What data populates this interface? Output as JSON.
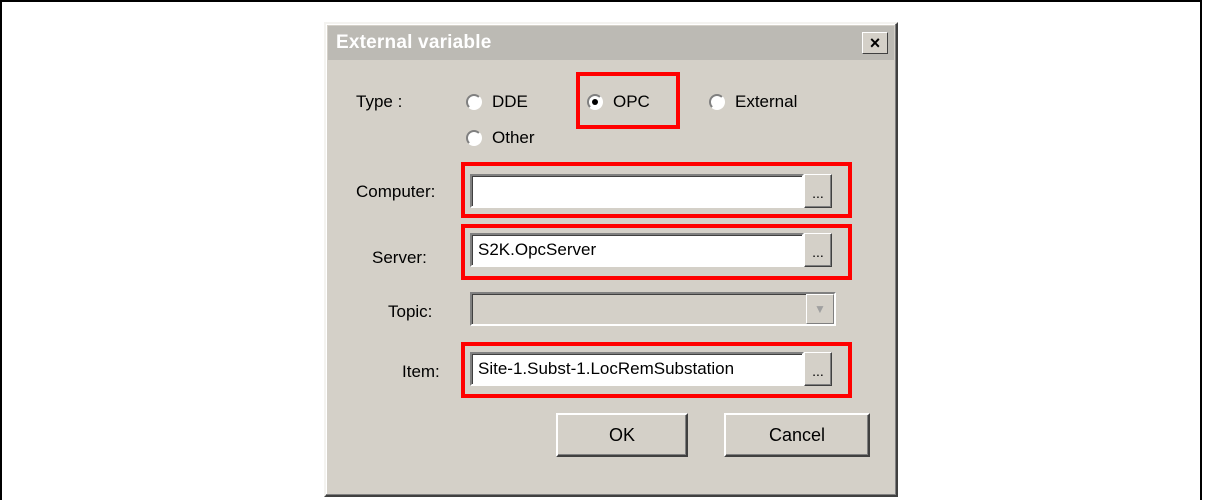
{
  "dialog": {
    "title": "External variable",
    "close_label": "×"
  },
  "type": {
    "label": "Type :",
    "options": [
      {
        "label": "DDE",
        "selected": false
      },
      {
        "label": "OPC",
        "selected": true
      },
      {
        "label": "External",
        "selected": false
      },
      {
        "label": "Other",
        "selected": false
      }
    ]
  },
  "computer": {
    "label": "Computer:",
    "value": "",
    "browse_label": "..."
  },
  "server": {
    "label": "Server:",
    "value": "S2K.OpcServer",
    "browse_label": "..."
  },
  "topic": {
    "label": "Topic:",
    "value": "",
    "dropdown_glyph": "▼"
  },
  "item": {
    "label": "Item:",
    "value": "Site-1.Subst-1.LocRemSubstation",
    "browse_label": "..."
  },
  "buttons": {
    "ok": "OK",
    "cancel": "Cancel"
  },
  "colors": {
    "highlight": "#ff0000",
    "dialog_bg": "#d4d0c8"
  }
}
